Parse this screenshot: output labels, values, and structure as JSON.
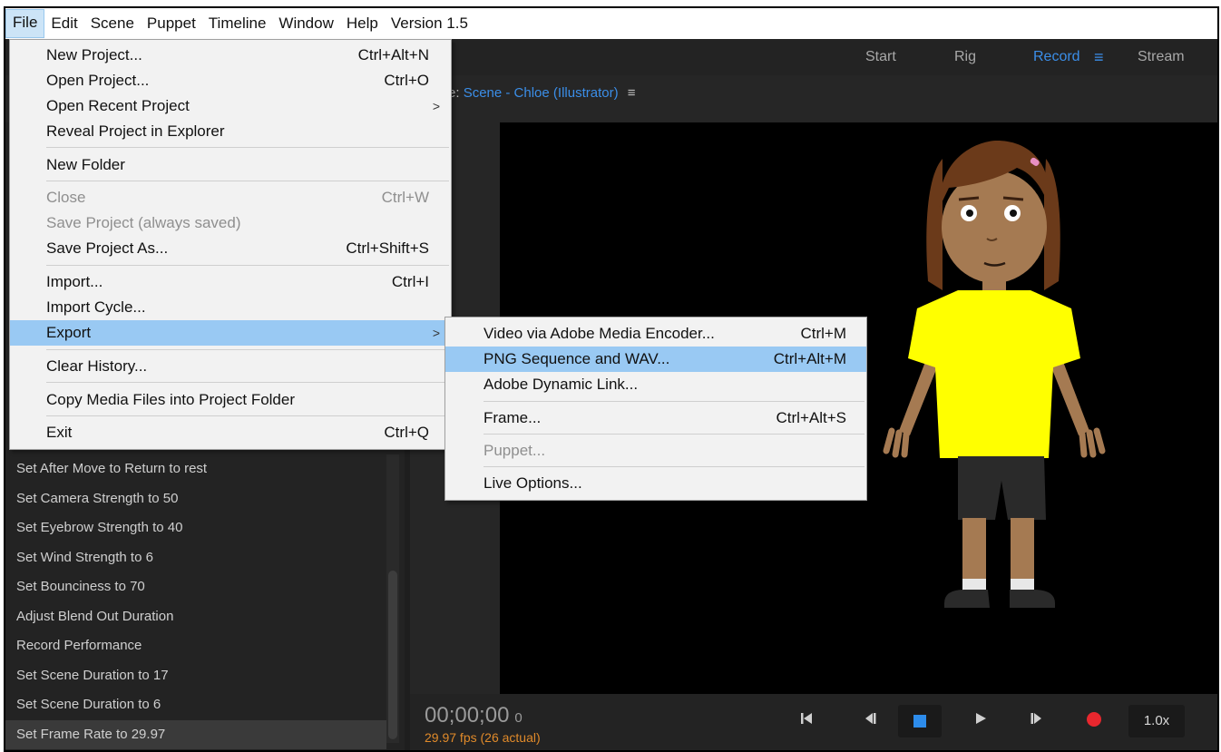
{
  "menubar": {
    "items": [
      "File",
      "Edit",
      "Scene",
      "Puppet",
      "Timeline",
      "Window",
      "Help",
      "Version 1.5"
    ]
  },
  "workspaces": {
    "start": "Start",
    "rig": "Rig",
    "record": "Record",
    "stream": "Stream"
  },
  "scene": {
    "prefix": "e:",
    "name": "Scene - Chloe (Illustrator)"
  },
  "file_menu": {
    "new_project": {
      "label": "New Project...",
      "shortcut": "Ctrl+Alt+N"
    },
    "open_project": {
      "label": "Open Project...",
      "shortcut": "Ctrl+O"
    },
    "open_recent": {
      "label": "Open Recent Project"
    },
    "reveal": {
      "label": "Reveal Project in Explorer"
    },
    "new_folder": {
      "label": "New Folder"
    },
    "close": {
      "label": "Close",
      "shortcut": "Ctrl+W"
    },
    "save_project": {
      "label": "Save Project (always saved)"
    },
    "save_as": {
      "label": "Save Project As...",
      "shortcut": "Ctrl+Shift+S"
    },
    "import": {
      "label": "Import...",
      "shortcut": "Ctrl+I"
    },
    "import_cycle": {
      "label": "Import Cycle..."
    },
    "export": {
      "label": "Export"
    },
    "clear_history": {
      "label": "Clear History..."
    },
    "copy_media": {
      "label": "Copy Media Files into Project Folder"
    },
    "exit": {
      "label": "Exit",
      "shortcut": "Ctrl+Q"
    }
  },
  "export_menu": {
    "video_ame": {
      "label": "Video via Adobe Media Encoder...",
      "shortcut": "Ctrl+M"
    },
    "png_wav": {
      "label": "PNG Sequence and WAV...",
      "shortcut": "Ctrl+Alt+M"
    },
    "dynamic_link": {
      "label": "Adobe Dynamic Link..."
    },
    "frame": {
      "label": "Frame...",
      "shortcut": "Ctrl+Alt+S"
    },
    "puppet": {
      "label": "Puppet..."
    },
    "live_options": {
      "label": "Live Options..."
    }
  },
  "history": [
    "Set After Move to Return to rest",
    "Set Camera Strength to 50",
    "Set Eyebrow Strength to 40",
    "Set Wind Strength to 6",
    "Set Bounciness to 70",
    "Adjust Blend Out Duration",
    "Record Performance",
    "Set Scene Duration to 17",
    "Set Scene Duration to 6",
    "Set Frame Rate to 29.97"
  ],
  "transport": {
    "timecode": "00;00;00",
    "frame": "0",
    "fps": "29.97 fps (26 actual)",
    "speed": "1.0x"
  },
  "colors": {
    "accent": "#3b8ee8",
    "menu_highlight": "#99c9f3",
    "record_red": "#e8272e",
    "shirt_yellow": "#ffff00"
  },
  "icons": {
    "hamburger": "menu-icon",
    "submenu": "chevron-right-icon",
    "first_frame": "go-to-start-icon",
    "prev_frame": "step-back-icon",
    "stop": "stop-icon",
    "play": "play-icon",
    "next_frame": "step-forward-icon",
    "record": "record-icon"
  }
}
